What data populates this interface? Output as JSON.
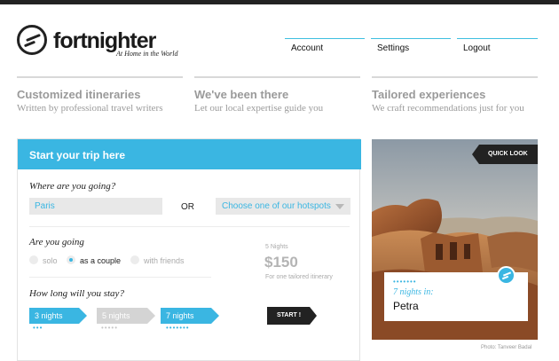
{
  "brand": {
    "name": "fortnighter",
    "tagline": "At Home in the World",
    "logo_icon": "fortnighter-logo-icon"
  },
  "nav": {
    "account": "Account",
    "settings": "Settings",
    "logout": "Logout"
  },
  "features": [
    {
      "title": "Customized itineraries",
      "subtitle": "Written by professional travel writers"
    },
    {
      "title": "We've been there",
      "subtitle": "Let our local expertise guide you"
    },
    {
      "title": "Tailored experiences",
      "subtitle": "We craft recommendations just for you"
    }
  ],
  "form": {
    "header": "Start your trip here",
    "where_question": "Where are you going?",
    "destination_value": "Paris",
    "or_label": "OR",
    "hotspot_label": "Choose one of our hotspots",
    "going_question": "Are you going",
    "options": [
      {
        "label": "solo",
        "selected": false
      },
      {
        "label": "as a couple",
        "selected": true
      },
      {
        "label": "with friends",
        "selected": false
      }
    ],
    "nights_label": "5 Nights",
    "price": "$150",
    "price_note": "For one tailored itinerary",
    "duration_question": "How long will you stay?",
    "durations": [
      {
        "label": "3 nights",
        "dots": "•••",
        "active": true
      },
      {
        "label": "5 nights",
        "dots": "•••••",
        "active": false
      },
      {
        "label": "7 nights",
        "dots": "•••••••",
        "active": true
      }
    ],
    "start_label": "START !"
  },
  "feature_panel": {
    "quick_look": "QUICK LOOK",
    "dots": "•••••••",
    "nights": "7 nights in:",
    "city": "Petra",
    "credit": "Photo: Tanveer Badal"
  },
  "colors": {
    "accent": "#3ab6e2",
    "dark": "#222222",
    "muted": "#9a9a9a"
  }
}
